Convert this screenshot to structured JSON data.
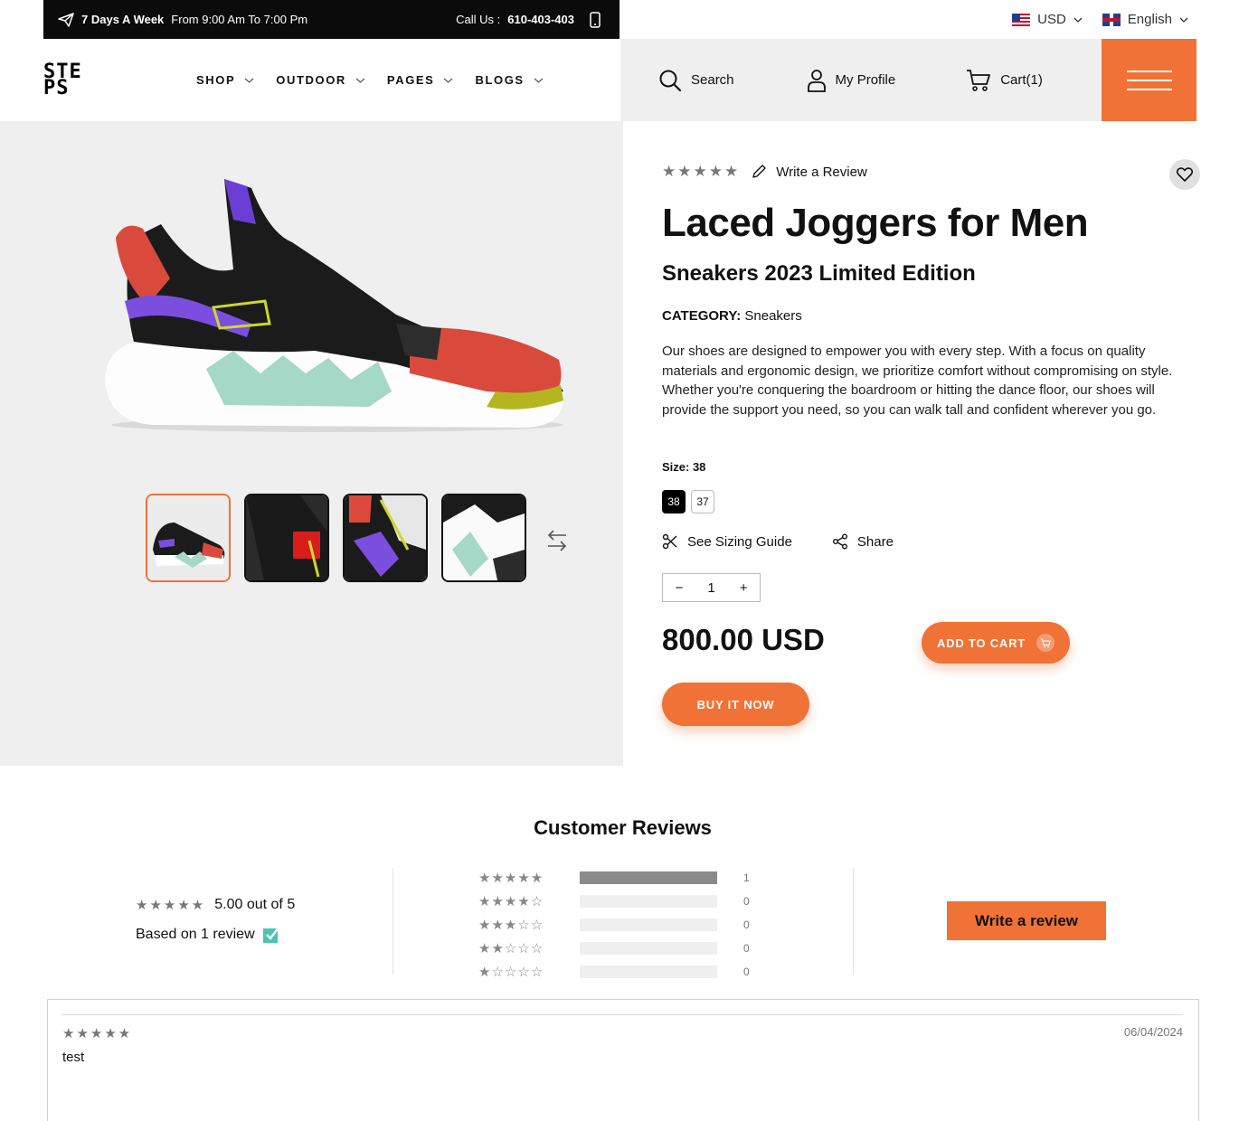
{
  "topbar": {
    "days_bold": "7 Days A Week",
    "hours": "From 9:00 Am To 7:00 Pm",
    "call_label": "Call Us :",
    "phone": "610-403-403"
  },
  "locale": {
    "currency": "USD",
    "language": "English"
  },
  "header": {
    "logo_line1": "STE",
    "logo_line2": "PS",
    "nav": [
      "SHOP",
      "OUTDOOR",
      "PAGES",
      "BLOGS"
    ],
    "search_label": "Search",
    "profile_label": "My Profile",
    "cart_label": "Cart(1)"
  },
  "product": {
    "review_link": "Write a Review",
    "title": "Laced Joggers for Men",
    "subtitle": "Sneakers 2023 Limited Edition",
    "category_label": "CATEGORY:",
    "category_value": "Sneakers",
    "description": "Our shoes are designed to empower you with every step. With a focus on quality materials and ergonomic design, we prioritize comfort without compromising on style. Whether you're conquering the boardroom or hitting the dance floor, our shoes will provide the support you need, so you can walk tall and confident wherever you go.",
    "size_label": "Size: 38",
    "sizes": [
      "38",
      "37"
    ],
    "sizing_guide": "See Sizing Guide",
    "share": "Share",
    "quantity": "1",
    "price": "800.00 USD",
    "add_to_cart": "ADD TO CART",
    "buy_now": "BUY IT NOW",
    "rating": 5
  },
  "reviews": {
    "heading": "Customer Reviews",
    "average": "5.00 out of 5",
    "based_on": "Based on 1 review",
    "histogram": [
      {
        "stars": 5,
        "count": "1",
        "fraction": 1.0
      },
      {
        "stars": 4,
        "count": "0",
        "fraction": 0
      },
      {
        "stars": 3,
        "count": "0",
        "fraction": 0
      },
      {
        "stars": 2,
        "count": "0",
        "fraction": 0
      },
      {
        "stars": 1,
        "count": "0",
        "fraction": 0
      }
    ],
    "write_button": "Write a review",
    "items": [
      {
        "stars": 5,
        "date": "06/04/2024",
        "text": "test"
      }
    ]
  },
  "colors": {
    "accent": "#f07236",
    "topbar": "#0b0b0b",
    "panel": "#efefef"
  }
}
